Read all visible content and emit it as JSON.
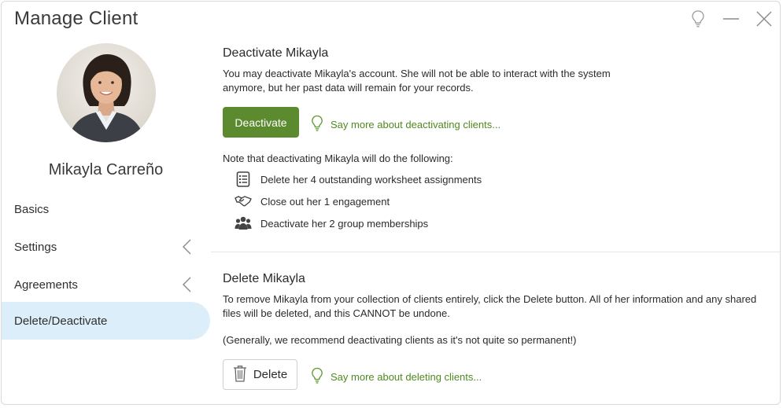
{
  "window": {
    "title": "Manage Client",
    "controls": [
      "lightbulb-icon",
      "minimize-icon",
      "close-icon"
    ]
  },
  "client": {
    "name": "Mikayla Carreño"
  },
  "sidebar": {
    "items": [
      {
        "label": "Basics",
        "has_chevron": false,
        "active": false
      },
      {
        "label": "Settings",
        "has_chevron": true,
        "active": false
      },
      {
        "label": "Agreements",
        "has_chevron": true,
        "active": false
      },
      {
        "label": "Delete/Deactivate",
        "has_chevron": false,
        "active": true
      }
    ]
  },
  "deactivate": {
    "title": "Deactivate Mikayla",
    "description_line1": "You may deactivate Mikayla's account. She will not be able to interact with the system",
    "description_line2": "anymore, but her past data will remain for your records.",
    "button_label": "Deactivate",
    "more_link": "Say more about deactivating clients...",
    "note": "Note that deactivating Mikayla will do the following:",
    "effects": [
      {
        "icon": "worksheet-list-icon",
        "text": "Delete her 4 outstanding worksheet assignments"
      },
      {
        "icon": "handshake-icon",
        "text": "Close out her 1 engagement"
      },
      {
        "icon": "group-icon",
        "text": "Deactivate her 2 group memberships"
      }
    ]
  },
  "delete": {
    "title": "Delete Mikayla",
    "description_line1": "To remove Mikayla from your collection of clients entirely, click the Delete button. All of her information and any shared",
    "description_line2": "files will be deleted, and this CANNOT be undone.",
    "recommendation": "(Generally, we recommend deactivating clients as it's not quite so permanent!)",
    "button_label": "Delete",
    "more_link": "Say more about deleting clients..."
  },
  "colors": {
    "accent_green": "#5c8a2f",
    "link_green": "#4f8a1f",
    "active_nav_bg": "#dceefa"
  }
}
